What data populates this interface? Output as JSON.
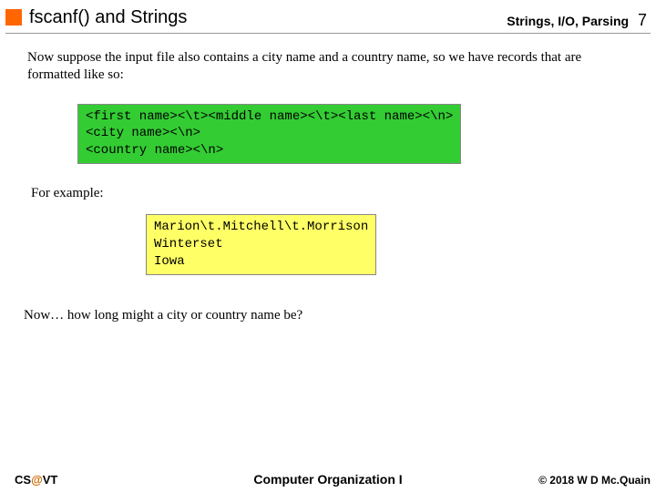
{
  "header": {
    "title": "fscanf() and Strings",
    "section": "Strings, I/O, Parsing",
    "pagenum": "7"
  },
  "body": {
    "intro": "Now suppose the input file also contains a city name and a country name, so we have records that are formatted like so:",
    "format_block": "<first name><\\t><middle name><\\t><last name><\\n>\n<city name><\\n>\n<country name><\\n>",
    "example_label": "For example:",
    "example_block": "Marion\\t.Mitchell\\t.Morrison\nWinterset\nIowa",
    "question": "Now… how long might a city or country name be?"
  },
  "footer": {
    "left_pre": "CS",
    "left_at": "@",
    "left_post": "VT",
    "center": "Computer Organization I",
    "right": "© 2018 W D Mc.Quain"
  }
}
